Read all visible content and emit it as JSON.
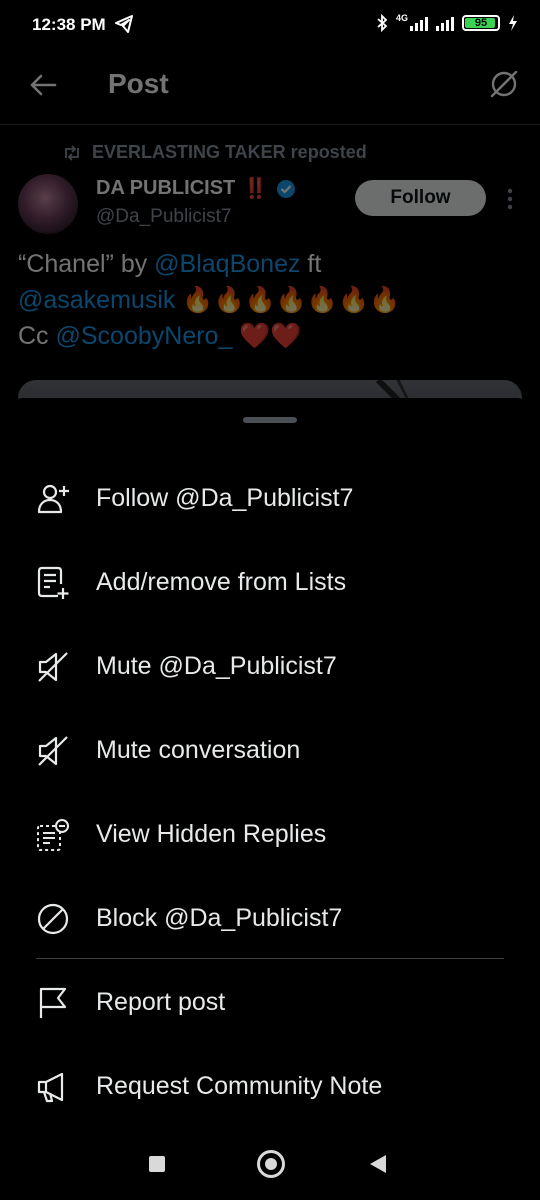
{
  "status_bar": {
    "time": "12:38 PM",
    "network": "4G",
    "battery": "95",
    "battery_fill": 0.95
  },
  "header": {
    "title": "Post"
  },
  "post": {
    "repost_label": "EVERLASTING TAKER reposted",
    "author_name": "DA PUBLICIST",
    "author_emoji": "‼️",
    "handle": "@Da_Publicist7",
    "follow_label": "Follow",
    "text": {
      "quote_open": "“Chanel” by ",
      "mention1": "@BlaqBonez",
      "ft": " ft",
      "mention2": "@asakemusik",
      "fires": " 🔥🔥🔥🔥🔥🔥🔥",
      "cc": "Cc ",
      "mention3": "@ScoobyNero_",
      "hearts": " ❤️❤️"
    }
  },
  "menu": {
    "items": [
      {
        "label": "Follow @Da_Publicist7",
        "icon": "follow-user-icon"
      },
      {
        "label": "Add/remove from Lists",
        "icon": "list-add-icon"
      },
      {
        "label": "Mute @Da_Publicist7",
        "icon": "mute-icon"
      },
      {
        "label": "Mute conversation",
        "icon": "mute-icon"
      },
      {
        "label": "View Hidden Replies",
        "icon": "hidden-replies-icon"
      },
      {
        "label": "Block @Da_Publicist7",
        "icon": "block-icon"
      },
      {
        "label": "Report post",
        "icon": "flag-icon"
      },
      {
        "label": "Request Community Note",
        "icon": "megaphone-icon"
      }
    ]
  },
  "colors": {
    "accent": "#1d9bf0",
    "background": "#000000",
    "battery": "#39d353"
  }
}
